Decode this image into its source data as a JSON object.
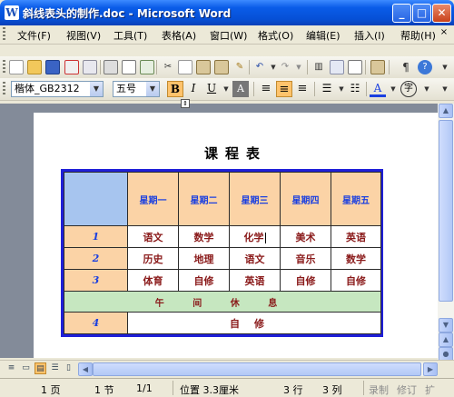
{
  "window": {
    "title": "斜线表头的制作.doc - Microsoft Word",
    "app_icon": "W",
    "controls": [
      "minimize-icon",
      "maximize-icon",
      "close-icon"
    ]
  },
  "menu": {
    "items": [
      "文件(F)",
      "视图(V)",
      "工具(T)",
      "表格(A)",
      "窗口(W)",
      "格式(O)",
      "编辑(E)",
      "插入(I)",
      "帮助(H)"
    ],
    "end": "×"
  },
  "format_bar": {
    "font_name": "楷体_GB2312",
    "font_size": "五号",
    "bold": "B",
    "italic": "I",
    "underline": "U",
    "char_style": "A",
    "font_color": "A",
    "char_border": "字",
    "bold_active": true,
    "alignment_active": "center"
  },
  "document": {
    "title": "课程表",
    "table": {
      "headers": [
        "星期一",
        "星期二",
        "星期三",
        "星期四",
        "星期五"
      ],
      "rows": [
        {
          "num": "1",
          "cells": [
            "语文",
            "数学",
            "化学",
            "美术",
            "英语"
          ]
        },
        {
          "num": "2",
          "cells": [
            "历史",
            "地理",
            "语文",
            "音乐",
            "数学"
          ]
        },
        {
          "num": "3",
          "cells": [
            "体育",
            "自修",
            "英语",
            "自修",
            "自修"
          ]
        }
      ],
      "break_label": "午 间 休 息",
      "row4_num": "4",
      "row4_label": "自修"
    }
  },
  "status": {
    "page": "1 页",
    "section": "1 节",
    "page_of": "1/1",
    "position": "位置 3.3厘米",
    "line": "3 行",
    "column": "3 列",
    "rec": "录制",
    "trk": "修订",
    "ext": "扩"
  },
  "colors": {
    "title_bar": "#0a5ce8",
    "table_border": "#1f1fd8",
    "header_fill": "#fbd3a6",
    "corner_fill": "#a7c5ef",
    "break_fill": "#c6e7c0",
    "cell_text": "#8a1a1a",
    "header_text": "#1a3fe0"
  }
}
